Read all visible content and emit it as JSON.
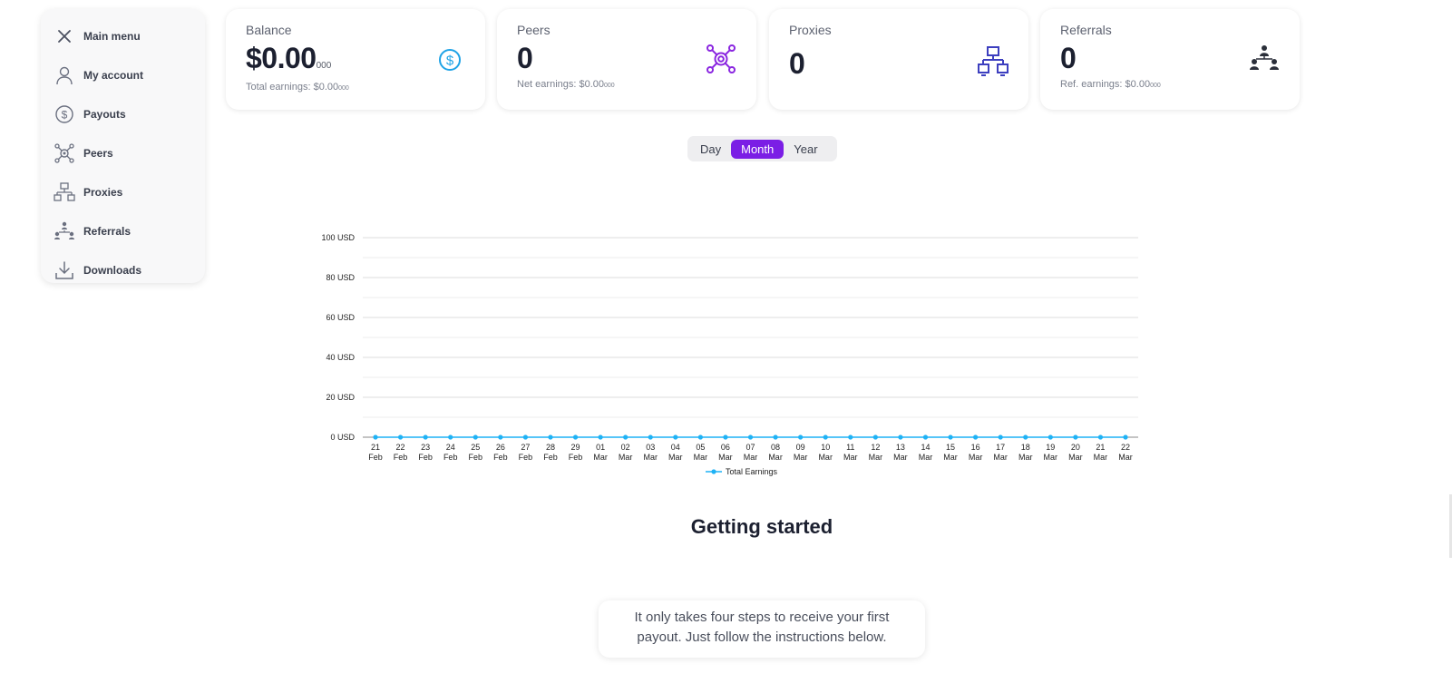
{
  "sidebar": {
    "items": [
      {
        "label": "Main menu",
        "icon": "close-icon"
      },
      {
        "label": "My account",
        "icon": "user-icon"
      },
      {
        "label": "Payouts",
        "icon": "dollar-icon"
      },
      {
        "label": "Peers",
        "icon": "peers-icon"
      },
      {
        "label": "Proxies",
        "icon": "proxies-icon"
      },
      {
        "label": "Referrals",
        "icon": "referrals-icon"
      },
      {
        "label": "Downloads",
        "icon": "download-icon"
      }
    ]
  },
  "cards": {
    "balance": {
      "title": "Balance",
      "value": "$0.00",
      "value_suffix": "000",
      "sub_label": "Total earnings: $0.00",
      "sub_suffix": "000",
      "icon": "dollar-circle-icon",
      "icon_color": "#1fa3e6"
    },
    "peers": {
      "title": "Peers",
      "value": "0",
      "sub_label": "Net earnings: $0.00",
      "sub_suffix": "000",
      "icon": "peers-network-icon",
      "icon_color": "#8a25e0"
    },
    "proxies": {
      "title": "Proxies",
      "value": "0",
      "icon": "proxies-network-icon",
      "icon_color": "#3d3fbf"
    },
    "referrals": {
      "title": "Referrals",
      "value": "0",
      "sub_label": "Ref. earnings: $0.00",
      "sub_suffix": "000",
      "icon": "referrals-group-icon",
      "icon_color": "#2b2f3a"
    }
  },
  "period_toggle": {
    "options": [
      "Day",
      "Month",
      "Year"
    ],
    "selected": "Month"
  },
  "chart_data": {
    "type": "line",
    "categories": [
      "21 Feb",
      "22 Feb",
      "23 Feb",
      "24 Feb",
      "25 Feb",
      "26 Feb",
      "27 Feb",
      "28 Feb",
      "29 Feb",
      "01 Mar",
      "02 Mar",
      "03 Mar",
      "04 Mar",
      "05 Mar",
      "06 Mar",
      "07 Mar",
      "08 Mar",
      "09 Mar",
      "10 Mar",
      "11 Mar",
      "12 Mar",
      "13 Mar",
      "14 Mar",
      "15 Mar",
      "16 Mar",
      "17 Mar",
      "18 Mar",
      "19 Mar",
      "20 Mar",
      "21 Mar",
      "22 Mar"
    ],
    "series": [
      {
        "name": "Total Earnings",
        "values": [
          0,
          0,
          0,
          0,
          0,
          0,
          0,
          0,
          0,
          0,
          0,
          0,
          0,
          0,
          0,
          0,
          0,
          0,
          0,
          0,
          0,
          0,
          0,
          0,
          0,
          0,
          0,
          0,
          0,
          0,
          0
        ],
        "color": "#1fb2f5"
      }
    ],
    "yticks": [
      "0 USD",
      "20 USD",
      "40 USD",
      "60 USD",
      "80 USD",
      "100 USD"
    ],
    "ylim": [
      0,
      100
    ],
    "grid": true,
    "legend": "bottom-center"
  },
  "getting_started": {
    "title": "Getting started",
    "text": "It only takes four steps to receive your first payout. Just follow the instructions below."
  }
}
